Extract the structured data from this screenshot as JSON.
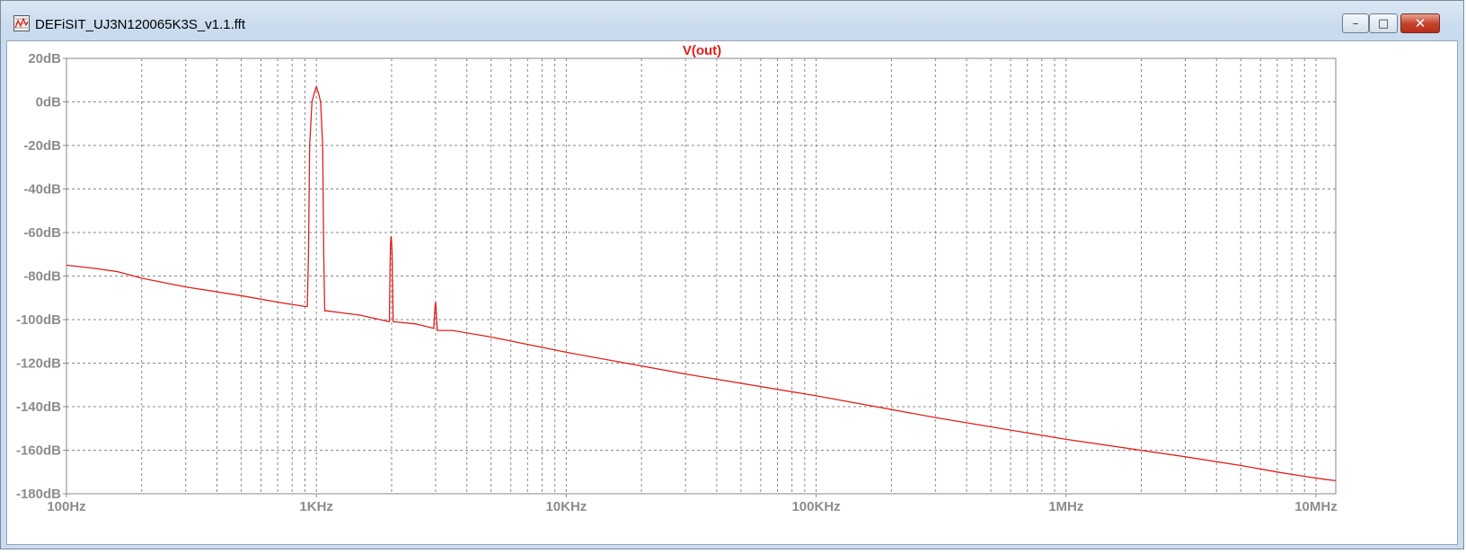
{
  "window": {
    "title": "DEFiSIT_UJ3N120065K3S_v1.1.fft",
    "controls": {
      "minimize": "–",
      "maximize": "□",
      "close": "✕"
    }
  },
  "icons": {
    "app": "waveform-viewer-icon",
    "minimize": "minimize-icon",
    "maximize": "maximize-icon",
    "close": "close-icon"
  },
  "colors": {
    "trace": "#e0201a",
    "axis_text": "#8c8c8c",
    "grid": "#8a8a8a"
  },
  "chart_data": {
    "type": "line",
    "title": "V(out)",
    "xscale": "log",
    "xlim": [
      100,
      12000000
    ],
    "ylim": [
      -180,
      20
    ],
    "grid": true,
    "y_ticks": [
      "20dB",
      "0dB",
      "-20dB",
      "-40dB",
      "-60dB",
      "-80dB",
      "-100dB",
      "-120dB",
      "-140dB",
      "-160dB",
      "-180dB"
    ],
    "y_tick_values": [
      20,
      0,
      -20,
      -40,
      -60,
      -80,
      -100,
      -120,
      -140,
      -160,
      -180
    ],
    "x_ticks": [
      "100Hz",
      "1KHz",
      "10KHz",
      "100KHz",
      "1MHz",
      "10MHz"
    ],
    "x_tick_values": [
      100,
      1000,
      10000,
      100000,
      1000000,
      10000000
    ],
    "series": [
      {
        "name": "V(out)",
        "x": [
          100,
          130,
          160,
          200,
          300,
          500,
          700,
          900,
          920,
          930,
          940,
          960,
          980,
          1000,
          1020,
          1040,
          1060,
          1070,
          1080,
          1100,
          1500,
          1960,
          1970,
          1980,
          1990,
          2000,
          2010,
          2020,
          2030,
          2040,
          2500,
          2950,
          2970,
          2990,
          3000,
          3010,
          3030,
          3050,
          3500,
          5000,
          10000,
          30000,
          100000,
          300000,
          1000000,
          3000000,
          5000000,
          7000000,
          9000000,
          11000000,
          12000000
        ],
        "y": [
          -75,
          -76.5,
          -78,
          -81,
          -85,
          -89,
          -92,
          -94,
          -94,
          -70,
          -20,
          0,
          4,
          7,
          4,
          0,
          -20,
          -70,
          -96,
          -96,
          -98,
          -101,
          -80,
          -66,
          -62,
          -64,
          -70,
          -85,
          -101,
          -101,
          -102,
          -104,
          -98,
          -93,
          -92,
          -94,
          -100,
          -105,
          -105,
          -108,
          -115,
          -125,
          -135,
          -145,
          -155,
          -163,
          -167,
          -170,
          -172,
          -173.5,
          -174
        ]
      }
    ]
  }
}
